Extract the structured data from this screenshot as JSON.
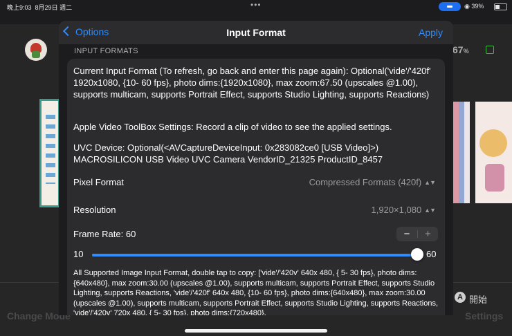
{
  "status_bar": {
    "time": "晚上9:03",
    "date": "8月29日 週二",
    "right": "39%"
  },
  "background_app": {
    "battery_percent": "67",
    "battery_unit": "%",
    "open_icon_letter": "A",
    "open_label": "開始",
    "bottom_left_label": "Change Mode",
    "bottom_right_label": "Settings"
  },
  "sheet": {
    "back_label": "Options",
    "title": "Input Format",
    "apply_label": "Apply",
    "section_header": "INPUT FORMATS",
    "current_input_format": "Current Input Format (To refresh, go back and enter this page again): Optional('vide'/'420f' 1920x1080, {10- 60 fps}, photo dims:{1920x1080}, max zoom:67.50 (upscales @1.00), supports multicam, supports Portrait Effect, supports Studio Lighting, supports Reactions)",
    "toolbox_settings": "Apple Video ToolBox Settings: Record a clip of video to see the applied settings.",
    "uvc_device": "UVC Device: Optional(<AVCaptureDeviceInput: 0x283082ce0 [USB Video]>) MACROSILICON USB Video UVC Camera VendorID_21325 ProductID_8457",
    "pixel_format": {
      "label": "Pixel Format",
      "value": "Compressed Formats (420f)"
    },
    "resolution": {
      "label": "Resolution",
      "value": "1,920×1,080"
    },
    "frame_rate": {
      "label": "Frame Rate: 60",
      "minus": "−",
      "plus": "+"
    },
    "slider": {
      "min_label": "10",
      "max_label": "60",
      "value": 60,
      "min": 10,
      "max": 60
    },
    "all_formats": "All Supported Image Input Format, double tap to copy: ['vide'/'420v'  640x 480, { 5- 30 fps}, photo dims:{640x480}, max zoom:30.00 (upscales @1.00), supports multicam, supports Portrait Effect, supports Studio Lighting, supports Reactions, 'vide'/'420f'  640x 480, {10- 60 fps}, photo dims:{640x480}, max zoom:30.00 (upscales @1.00), supports multicam, supports Portrait Effect, supports Studio Lighting, supports Reactions, 'vide'/'420v'  720x 480, { 5- 30 fps}, photo dims:{720x480},"
  },
  "colors": {
    "accent": "#2f8dff",
    "sheet_bg": "#1c1c1e",
    "group_bg": "#2c2c2e",
    "secondary_text": "#9a9a9f"
  }
}
